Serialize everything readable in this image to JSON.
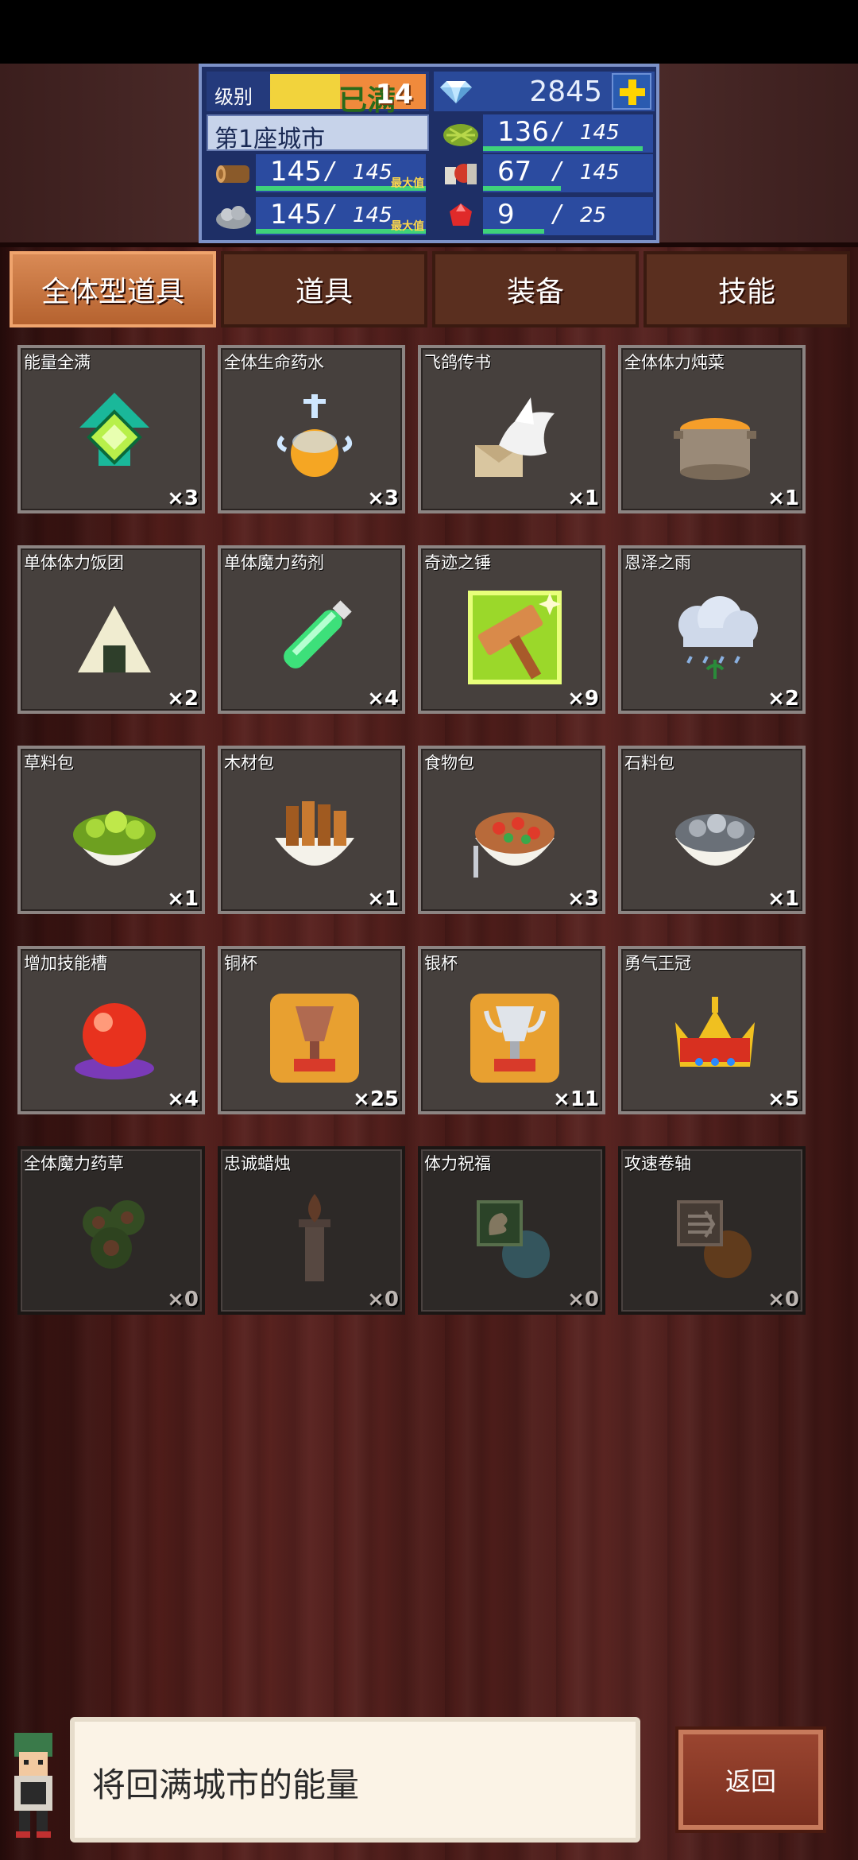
{
  "status": {
    "level_label": "级别",
    "level_max": "已满",
    "level_value": "14",
    "gems": "2845",
    "city_name": "第1座城市",
    "wood": {
      "current": "145",
      "max": "145",
      "max_tag": "最大值",
      "fill": 1.0
    },
    "stone": {
      "current": "145",
      "max": "145",
      "max_tag": "最大值",
      "fill": 1.0
    },
    "grass": {
      "current": "136",
      "max": "145",
      "fill": 0.94
    },
    "food": {
      "current": "67",
      "max": "145",
      "fill": 0.46
    },
    "ruby": {
      "current": "9",
      "max": "25",
      "fill": 0.36
    }
  },
  "tabs": [
    {
      "label": "全体型道具",
      "active": true
    },
    {
      "label": "道具",
      "active": false
    },
    {
      "label": "装备",
      "active": false
    },
    {
      "label": "技能",
      "active": false
    }
  ],
  "items": [
    {
      "name": "能量全满",
      "count": "×3",
      "icon": "energy-arrow-icon"
    },
    {
      "name": "全体生命药水",
      "count": "×3",
      "icon": "potion-flask-icon"
    },
    {
      "name": "飞鸽传书",
      "count": "×1",
      "icon": "pigeon-letter-icon"
    },
    {
      "name": "全体体力炖菜",
      "count": "×1",
      "icon": "stew-pot-icon"
    },
    {
      "name": "单体体力饭团",
      "count": "×2",
      "icon": "rice-ball-icon"
    },
    {
      "name": "单体魔力药剂",
      "count": "×4",
      "icon": "green-vial-icon"
    },
    {
      "name": "奇迹之锤",
      "count": "×9",
      "icon": "miracle-hammer-icon"
    },
    {
      "name": "恩泽之雨",
      "count": "×2",
      "icon": "rain-cloud-icon"
    },
    {
      "name": "草料包",
      "count": "×1",
      "icon": "grass-bag-icon"
    },
    {
      "name": "木材包",
      "count": "×1",
      "icon": "wood-bag-icon"
    },
    {
      "name": "食物包",
      "count": "×3",
      "icon": "food-bag-icon"
    },
    {
      "name": "石料包",
      "count": "×1",
      "icon": "stone-bag-icon"
    },
    {
      "name": "增加技能槽",
      "count": "×4",
      "icon": "red-orb-icon"
    },
    {
      "name": "铜杯",
      "count": "×25",
      "icon": "bronze-cup-icon"
    },
    {
      "name": "银杯",
      "count": "×11",
      "icon": "silver-cup-icon"
    },
    {
      "name": "勇气王冠",
      "count": "×5",
      "icon": "crown-icon"
    },
    {
      "name": "全体魔力药草",
      "count": "×0",
      "icon": "herb-icon",
      "locked": true
    },
    {
      "name": "忠诚蜡烛",
      "count": "×0",
      "icon": "candle-icon",
      "locked": true
    },
    {
      "name": "体力祝福",
      "count": "×0",
      "icon": "strength-blessing-icon",
      "locked": true
    },
    {
      "name": "攻速卷轴",
      "count": "×0",
      "icon": "speed-scroll-icon",
      "locked": true
    }
  ],
  "description": "将回满城市的能量",
  "back_label": "返回"
}
